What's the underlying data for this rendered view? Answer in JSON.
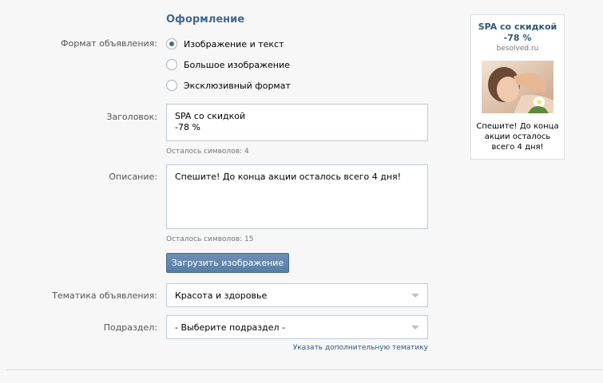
{
  "section": {
    "title": "Оформление"
  },
  "format": {
    "label": "Формат объявления:",
    "options": [
      {
        "label": "Изображение и текст",
        "selected": true
      },
      {
        "label": "Большое изображение",
        "selected": false
      },
      {
        "label": "Эксклюзивный формат",
        "selected": false
      }
    ]
  },
  "headline": {
    "label": "Заголовок:",
    "value": "SPA со скидкой\n-78 %",
    "hint": "Осталось символов: 4"
  },
  "description": {
    "label": "Описание:",
    "value": "Спешите! До конца акции осталось всего 4 дня!",
    "hint": "Осталось символов: 15"
  },
  "upload_button": "Загрузить изображение",
  "topic": {
    "label": "Тематика объявления:",
    "value": "Красота и здоровье"
  },
  "subsection": {
    "label": "Подраздел:",
    "value": "- Выберите подраздел -"
  },
  "extra_topic_link": "Указать дополнительную тематику",
  "preview": {
    "title": "SPA со скидкой\n-78 %",
    "domain": "besolved.ru",
    "text": "Спешите! До конца акции осталось всего 4 дня!"
  }
}
